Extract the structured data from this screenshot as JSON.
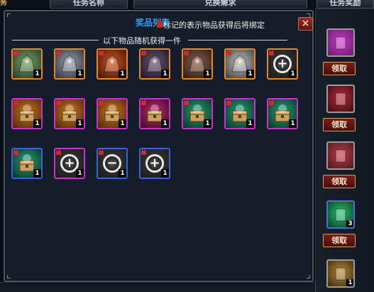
{
  "background": {
    "left_fragment": "务",
    "tabs": [
      {
        "label": "任务名称"
      },
      {
        "label": "兑换需求"
      },
      {
        "label": "任务奖励"
      }
    ],
    "rewards": [
      {
        "name": "gift-bag",
        "count": "",
        "colors": [
          "#6a1a6b",
          "#c33bc7"
        ],
        "border": "#9b9b9b",
        "icon": "bag-icon"
      },
      {
        "name": "vip-card",
        "count": "",
        "colors": [
          "#3b0f12",
          "#b52a37"
        ],
        "border": "#9b9b9b",
        "icon": "card-icon"
      },
      {
        "name": "equipment-card",
        "count": "",
        "colors": [
          "#4a1a1a",
          "#c0394f"
        ],
        "border": "#9b9b9b",
        "icon": "card-icon"
      },
      {
        "name": "green-potion",
        "count": "3",
        "colors": [
          "#0c3a2a",
          "#23c46a"
        ],
        "border": "#4c6fd4",
        "icon": "potion-icon"
      },
      {
        "name": "golden-book",
        "count": "1",
        "colors": [
          "#3a2a0a",
          "#b9883a"
        ],
        "border": "#9b9b9b",
        "icon": "book-icon"
      }
    ],
    "claim_label": "领取"
  },
  "modal": {
    "title": "奖品列表",
    "bind_note": "标记的表示物品获得后将绑定",
    "section_title": "以下物品随机获得一件",
    "close_label": "×",
    "items": [
      {
        "name": "green-dragon-mount",
        "count": "1",
        "bound": true,
        "border": "#e08a2a",
        "colors": [
          "#1b3b2d",
          "#7ea15c"
        ],
        "icon": "dragon-icon"
      },
      {
        "name": "white-beast-mount",
        "count": "1",
        "bound": true,
        "border": "#e08a2a",
        "colors": [
          "#2b2f3a",
          "#9aa2b0"
        ],
        "icon": "beast-icon"
      },
      {
        "name": "fire-phoenix-mount",
        "count": "1",
        "bound": true,
        "border": "#e08a2a",
        "colors": [
          "#3a1208",
          "#d4581f"
        ],
        "icon": "phoenix-icon"
      },
      {
        "name": "dark-wolf-mount",
        "count": "1",
        "bound": true,
        "border": "#e08a2a",
        "colors": [
          "#1a1420",
          "#6b5477"
        ],
        "icon": "wolf-icon"
      },
      {
        "name": "dark-knight-mount",
        "count": "1",
        "bound": true,
        "border": "#e08a2a",
        "colors": [
          "#2a1a16",
          "#8c5e48"
        ],
        "icon": "knight-icon"
      },
      {
        "name": "silver-fox-mount",
        "count": "1",
        "bound": true,
        "border": "#e08a2a",
        "colors": [
          "#3a3b3d",
          "#c6c3bb"
        ],
        "icon": "fox-icon"
      },
      {
        "name": "magnifier-plus-1",
        "count": "1",
        "bound": true,
        "border": "#e08a2a",
        "colors": [
          "#1a1a1a",
          "#3a3a3a"
        ],
        "icon": "plus-icon"
      },
      {
        "name": "orange-treasure-chest-1",
        "count": "1",
        "bound": true,
        "border": "#c535c8",
        "colors": [
          "#4a230a",
          "#d07a1e"
        ],
        "icon": "chest-icon"
      },
      {
        "name": "orange-treasure-chest-2",
        "count": "1",
        "bound": true,
        "border": "#c535c8",
        "colors": [
          "#4a230a",
          "#d07a1e"
        ],
        "icon": "chest-icon"
      },
      {
        "name": "orange-treasure-chest-3",
        "count": "1",
        "bound": true,
        "border": "#c535c8",
        "colors": [
          "#4a230a",
          "#d07a1e"
        ],
        "icon": "chest-icon"
      },
      {
        "name": "purple-treasure-chest",
        "count": "1",
        "bound": true,
        "border": "#c535c8",
        "colors": [
          "#3a0a2a",
          "#c0296b"
        ],
        "icon": "chest-icon"
      },
      {
        "name": "green-treasure-chest-1",
        "count": "1",
        "bound": true,
        "border": "#c535c8",
        "colors": [
          "#0a2e2a",
          "#23a574"
        ],
        "icon": "chest-icon"
      },
      {
        "name": "green-treasure-chest-2",
        "count": "1",
        "bound": true,
        "border": "#c535c8",
        "colors": [
          "#0a2e2a",
          "#23a574"
        ],
        "icon": "chest-icon"
      },
      {
        "name": "green-treasure-chest-3",
        "count": "1",
        "bound": true,
        "border": "#c535c8",
        "colors": [
          "#0a2e2a",
          "#23a574"
        ],
        "icon": "chest-icon"
      },
      {
        "name": "green-treasure-chest-4",
        "count": "1",
        "bound": true,
        "border": "#3b63d9",
        "colors": [
          "#0a2e2a",
          "#23a574"
        ],
        "icon": "chest-icon"
      },
      {
        "name": "magnifier-plus-2",
        "count": "1",
        "bound": true,
        "border": "#c535c8",
        "colors": [
          "#1a1a1a",
          "#3a3a3a"
        ],
        "icon": "plus-icon"
      },
      {
        "name": "magnifier-minus",
        "count": "1",
        "bound": true,
        "border": "#3b63d9",
        "colors": [
          "#1a1a1a",
          "#3a3a3a"
        ],
        "icon": "minus-icon"
      },
      {
        "name": "magnifier-plus-3",
        "count": "1",
        "bound": true,
        "border": "#3b63d9",
        "colors": [
          "#1a1a1a",
          "#3a3a3a"
        ],
        "icon": "plus-icon"
      }
    ]
  }
}
